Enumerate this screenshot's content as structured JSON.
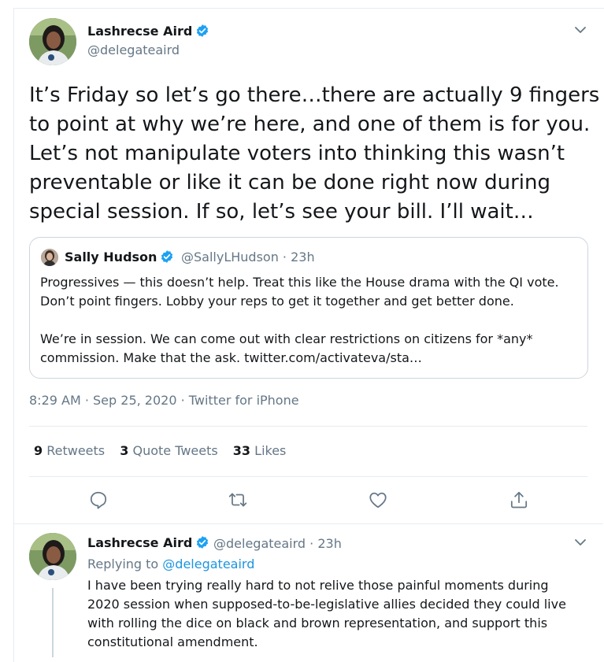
{
  "main_tweet": {
    "author_name": "Lashrecse Aird",
    "author_handle": "@delegateaird",
    "text_lines": [
      "It’s Friday so let’s go there…there are actually 9 fingers",
      "to point at why we’re here, and one of them is for you.",
      "Let’s not manipulate voters into thinking this wasn’t",
      "preventable or like it can be done right now during",
      "special session. If so, let’s see your bill. I’ll wait…"
    ],
    "timestamp": "8:29 AM · Sep 25, 2020 · Twitter for iPhone",
    "stats": {
      "retweets_count": "9",
      "retweets_label": "Retweets",
      "quotes_count": "3",
      "quotes_label": "Quote Tweets",
      "likes_count": "33",
      "likes_label": "Likes"
    }
  },
  "quoted_tweet": {
    "author_name": "Sally Hudson",
    "meta": "@SallyLHudson · 23h",
    "lines": [
      "Progressives — this doesn’t help. Treat this like the House drama with the QI vote.",
      "Don’t point fingers. Lobby your reps to get it together and get better done.",
      "",
      "We’re in session. We can come out with clear restrictions on citizens for *any*",
      "commission. Make that the ask. twitter.com/activateva/sta…"
    ]
  },
  "reply_tweet": {
    "author_name": "Lashrecse Aird",
    "meta": "@delegateaird · 23h",
    "replying_prefix": "Replying to",
    "replying_handle": "@delegateaird",
    "lines": [
      "I have been trying really hard to not relive those painful moments during",
      "2020 session when supposed-to-be-legislative allies decided they could live",
      "with rolling the dice on black and brown representation, and support this",
      "constitutional amendment."
    ]
  },
  "colors": {
    "verified_blue": "#1da1f2",
    "link_blue": "#1b95e0",
    "secondary_text": "#657786",
    "border": "#e6ecf0"
  },
  "icons": [
    "verified-badge-icon",
    "chevron-down-icon",
    "reply-icon",
    "retweet-icon",
    "like-icon",
    "share-icon"
  ]
}
